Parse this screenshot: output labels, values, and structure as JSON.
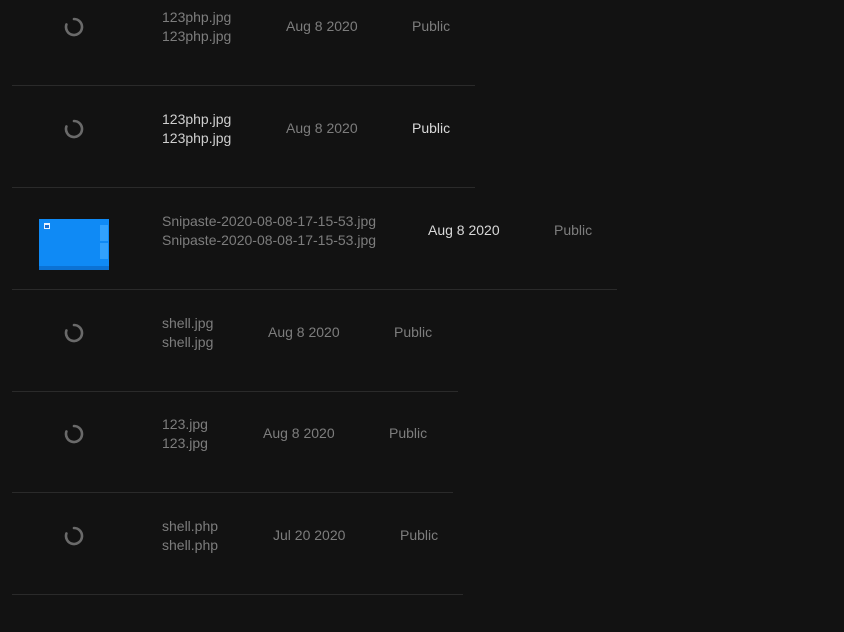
{
  "files": [
    {
      "name": "123php.jpg",
      "title": "123php.jpg",
      "date": "Aug 8 2020",
      "visibility": "Public",
      "thumbnail": "loading-spinner-icon"
    },
    {
      "name": "123php.jpg",
      "title": "123php.jpg",
      "date": "Aug 8 2020",
      "visibility": "Public",
      "thumbnail": "loading-spinner-icon"
    },
    {
      "name": "Snipaste-2020-08-08-17-15-53.jpg",
      "title": "Snipaste-2020-08-08-17-15-53.jpg",
      "date": "Aug 8 2020",
      "visibility": "Public",
      "thumbnail": "image-thumbnail"
    },
    {
      "name": "shell.jpg",
      "title": "shell.jpg",
      "date": "Aug 8 2020",
      "visibility": "Public",
      "thumbnail": "loading-spinner-icon"
    },
    {
      "name": "123.jpg",
      "title": "123.jpg",
      "date": "Aug 8 2020",
      "visibility": "Public",
      "thumbnail": "loading-spinner-icon"
    },
    {
      "name": "shell.php",
      "title": "shell.php",
      "date": "Jul 20 2020",
      "visibility": "Public",
      "thumbnail": "loading-spinner-icon"
    }
  ],
  "colors": {
    "background": "#121212",
    "divider": "#2a2a2a",
    "text_muted": "#7d7d7d",
    "text_highlight": "#d8d8d8",
    "thumbnail_blue": "#0a84f0"
  }
}
